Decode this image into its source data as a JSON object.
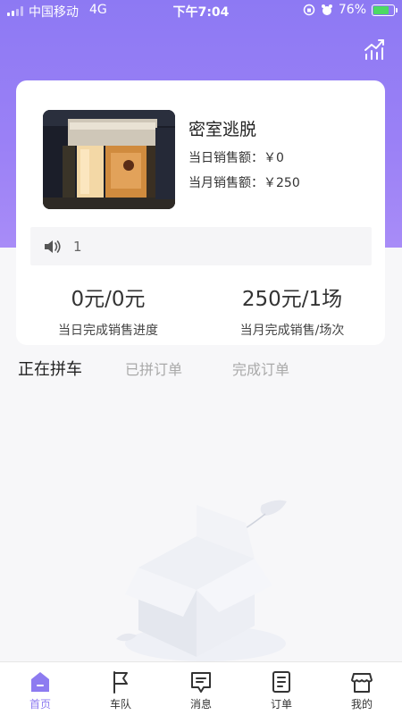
{
  "status_bar": {
    "carrier": "中国移动",
    "network": "4G",
    "time": "下午7:04",
    "battery": "76%",
    "battery_level": 0.76
  },
  "header": {
    "chart_icon": "trend-chart-icon"
  },
  "store_card": {
    "name": "密室逃脱",
    "daily_sales_label": "当日销售额：",
    "daily_sales_value": "￥0",
    "monthly_sales_label": "当月销售额：",
    "monthly_sales_value": "￥250",
    "notice_count": "1",
    "stats": [
      {
        "value": "0元/0元",
        "label": "当日完成销售进度"
      },
      {
        "value": "250元/1场",
        "label": "当月完成销售/场次"
      }
    ]
  },
  "tabs": [
    {
      "label": "正在拼车",
      "active": true
    },
    {
      "label": "已拼订单",
      "active": false
    },
    {
      "label": "完成订单",
      "active": false
    }
  ],
  "bottom_nav": [
    {
      "label": "首页",
      "icon": "home-icon",
      "active": true
    },
    {
      "label": "车队",
      "icon": "flag-icon",
      "active": false
    },
    {
      "label": "消息",
      "icon": "message-icon",
      "active": false
    },
    {
      "label": "订单",
      "icon": "order-icon",
      "active": false
    },
    {
      "label": "我的",
      "icon": "store-icon",
      "active": false
    }
  ],
  "colors": {
    "accent": "#8d7bf0",
    "header_gradient_top": "#8d79f3",
    "header_gradient_bottom": "#a88cf7"
  }
}
